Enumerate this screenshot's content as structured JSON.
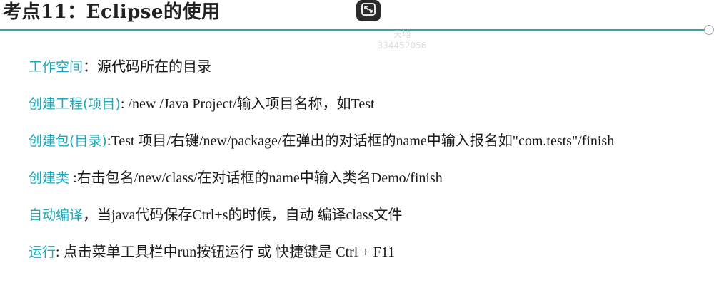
{
  "slide": {
    "title": "考点11：Eclipse的使用"
  },
  "watermark": {
    "line1": "天地",
    "line2": "334452056"
  },
  "items": [
    {
      "label": "工作空间",
      "text": "：源代码所在的目录"
    },
    {
      "label": "创建工程(项目)",
      "text": ": /new /Java Project/输入项目名称，如Test"
    },
    {
      "label": "创建包(目录)",
      "text": ":Test 项目/右键/new/package/在弹出的对话框的name中输入报名如\"com.tests\"/finish"
    },
    {
      "label": "创建类",
      "text": "  :右击包名/new/class/在对话框的name中输入类名Demo/finish"
    },
    {
      "label": "自动编译",
      "text": "，当java代码保存Ctrl+s的时候，自动 编译class文件"
    },
    {
      "label": "运行",
      "text": ": 点击菜单工具栏中run按钮运行 或 快捷键是 Ctrl + F11"
    }
  ],
  "icons": {
    "restore": "restore-window-icon"
  },
  "colors": {
    "accent": "#1aa9bb",
    "rule": "#2aa6a6",
    "button": "#2b2b2b"
  }
}
